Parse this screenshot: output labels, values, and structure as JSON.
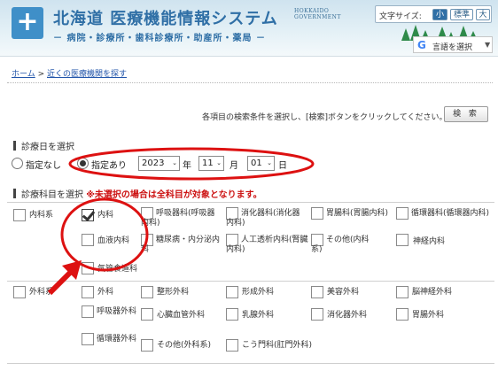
{
  "header": {
    "title": "北海道 医療機能情報システム",
    "title_en_line1": "HOKKAIDO",
    "title_en_line2": "GOVERNMENT",
    "subtitle": "－ 病院・診療所・歯科診療所・助産所・薬局 －",
    "logo_glyph": "+",
    "font_size_label": "文字サイズ:",
    "font_size_small": "小",
    "font_size_standard": "標準",
    "font_size_large": "大",
    "font_size_selected": "小",
    "translate_g": "G",
    "translate_label": "言語を選択",
    "translate_arrow": "▼"
  },
  "breadcrumb": {
    "home": "ホーム",
    "separator": " > ",
    "current": "近くの医療機関を探す"
  },
  "search": {
    "instruction": "各項目の検索条件を選択し、[検索]ボタンをクリックしてください。→",
    "button_label": "検 索"
  },
  "date_section": {
    "heading": "診療日を選択",
    "option_none": "指定なし",
    "option_specified": "指定あり",
    "selected_option": "指定あり",
    "year": "2023",
    "year_unit": "年",
    "month": "11",
    "month_unit": "月",
    "day": "01",
    "day_unit": "日",
    "arrow": "⌄"
  },
  "dept_section": {
    "heading": "診療科目を選択",
    "note": "※未選択の場合は全科目が対象となります。",
    "groups": [
      {
        "label": "内科系",
        "items": [
          {
            "label": "内科",
            "checked": true
          },
          {
            "label": "呼吸器科(呼吸器内科)",
            "checked": false
          },
          {
            "label": "消化器科(消化器内科)",
            "checked": false
          },
          {
            "label": "胃腸科(胃腸内科)",
            "checked": false
          },
          {
            "label": "循環器科(循環器内科)",
            "checked": false
          },
          {
            "label": "血液内科",
            "checked": false
          },
          {
            "label": "糖尿病・内分泌内科",
            "checked": false
          },
          {
            "label": "人工透析内科(腎臓内科)",
            "checked": false
          },
          {
            "label": "その他(内科系)",
            "checked": false
          },
          {
            "label": "神経内科",
            "checked": false
          },
          {
            "label": "気管食道科",
            "checked": false
          }
        ]
      },
      {
        "label": "外科系",
        "items": [
          {
            "label": "外科",
            "checked": false
          },
          {
            "label": "整形外科",
            "checked": false
          },
          {
            "label": "形成外科",
            "checked": false
          },
          {
            "label": "美容外科",
            "checked": false
          },
          {
            "label": "脳神経外科",
            "checked": false
          },
          {
            "label": "呼吸器外科",
            "checked": false
          },
          {
            "label": "心臓血管外科",
            "checked": false
          },
          {
            "label": "乳腺外科",
            "checked": false
          },
          {
            "label": "消化器外科",
            "checked": false
          },
          {
            "label": "胃腸外科",
            "checked": false
          },
          {
            "label": "循環器外科",
            "checked": false
          },
          {
            "label": "その他(外科系)",
            "checked": false
          },
          {
            "label": "こう門科(肛門外科)",
            "checked": false
          }
        ]
      }
    ]
  },
  "colors": {
    "annotation_red": "#dd1111",
    "header_blue": "#2f6fa6"
  }
}
